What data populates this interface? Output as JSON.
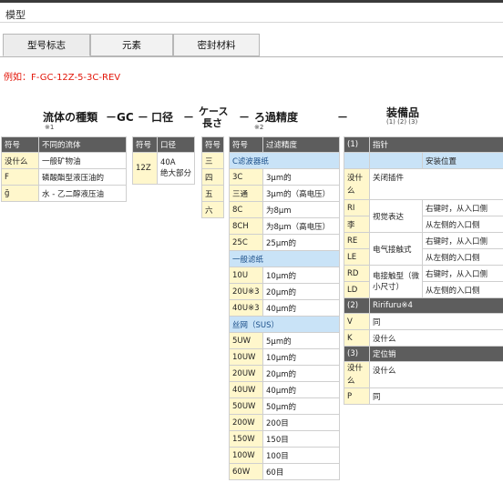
{
  "page": {
    "section_title": "模型",
    "example": "例如：F-GC-12Z-5-3C-REV"
  },
  "tabs": [
    "型号标志",
    "元素",
    "密封材料"
  ],
  "headers": {
    "fluid": "流体の種類",
    "fluid_note": "※1",
    "dash1": "－GC －",
    "diameter": "口径",
    "dash2": "－",
    "case_line1": "ケース",
    "case_line2": "長さ",
    "dash3": "－",
    "filter": "ろ過精度",
    "filter_note": "※2",
    "dash4": "－",
    "equip": "装備品",
    "equip_note": "(1) (2) (3)"
  },
  "fluid_table": {
    "col_code": "符号",
    "col_name": "不同的流体",
    "rows": [
      {
        "code": "没什么",
        "name": "一般矿物油"
      },
      {
        "code": "F",
        "name": "磷酸酯型液压油的"
      },
      {
        "code": "ğ",
        "name": "水 - 乙二醇液压油"
      }
    ]
  },
  "diameter_table": {
    "col_code": "符号",
    "col_name": "口径",
    "rows": [
      {
        "code": "12Z",
        "name1": "40A",
        "name2": "绝大部分"
      }
    ]
  },
  "case_table": {
    "col_code": "符号",
    "rows": [
      "三",
      "四",
      "五",
      "六"
    ]
  },
  "filter_table": {
    "col_code": "符号",
    "col_name": "过滤精度",
    "groups": [
      {
        "title": "C滤波器纸",
        "rows": [
          {
            "code": "3C",
            "value": "3μm的"
          },
          {
            "code": "三通",
            "value": "3μm的（高电压）"
          },
          {
            "code": "8C",
            "value": "为8μm"
          },
          {
            "code": "8CH",
            "value": "为8μm（高电压）"
          },
          {
            "code": "25C",
            "value": "25μm的"
          }
        ]
      },
      {
        "title": "一般滤纸",
        "rows": [
          {
            "code": "10U",
            "value": "10μm的"
          },
          {
            "code": "20U※3",
            "value": "20μm的"
          },
          {
            "code": "40U※3",
            "value": "40μm的"
          }
        ]
      },
      {
        "title": "丝网（SUS）",
        "rows": [
          {
            "code": "5UW",
            "value": "5μm的"
          },
          {
            "code": "10UW",
            "value": "10μm的"
          },
          {
            "code": "20UW",
            "value": "20μm的"
          },
          {
            "code": "40UW",
            "value": "40μm的"
          },
          {
            "code": "50UW",
            "value": "50μm的"
          },
          {
            "code": "200W",
            "value": "200目"
          },
          {
            "code": "150W",
            "value": "150目"
          },
          {
            "code": "100W",
            "value": "100目"
          },
          {
            "code": "60W",
            "value": "60目"
          }
        ]
      }
    ]
  },
  "equip_table": {
    "g1_num": "(1)",
    "g1_name": "指针",
    "g1_col": "安装位置",
    "none_code": "没什么",
    "none_text": "关闭插件",
    "ri": "RI",
    "li": "李",
    "ri_name": "视觉表达",
    "re": "RE",
    "le": "LE",
    "re_name": "电气接触式",
    "rd": "RD",
    "ld": "LD",
    "rd_name": "电接触型（微小尺寸）",
    "right_in": "右键时，从入口侧",
    "left_in": "从左侧的入口侧",
    "g2_num": "(2)",
    "g2_name": "Ririfuru※4",
    "v_code": "V",
    "v_text": "同",
    "k_code": "K",
    "k_text": "没什么",
    "g3_num": "(3)",
    "g3_name": "定位销",
    "none3_code": "没什么",
    "none3_text": "没什么",
    "p_code": "P",
    "p_text": "同"
  }
}
